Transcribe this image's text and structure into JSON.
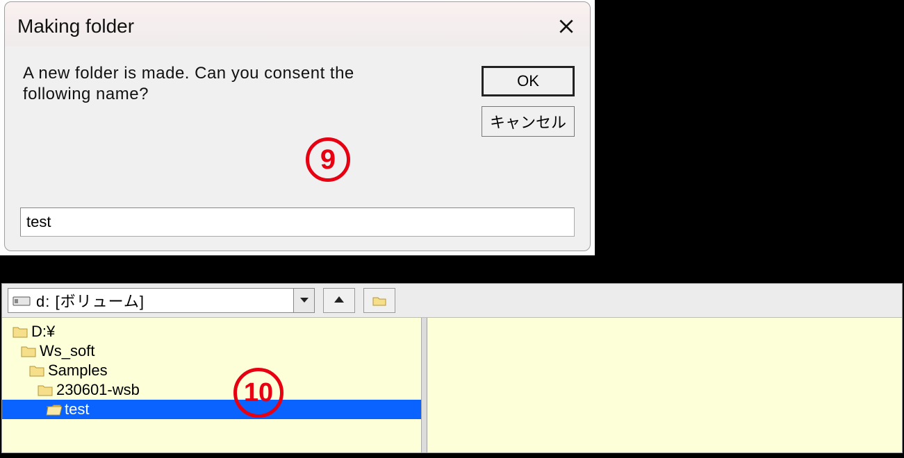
{
  "dialog": {
    "title": "Making folder",
    "message": "A new folder is made. Can you consent the following name?",
    "ok_label": "OK",
    "cancel_label": "キャンセル",
    "input_value": "test"
  },
  "annotations": {
    "n9": "9",
    "n10": "10"
  },
  "panel": {
    "drive_label": "d: [ボリューム]",
    "tree": [
      {
        "label": "D:¥",
        "indent": 0,
        "selected": false
      },
      {
        "label": "Ws_soft",
        "indent": 1,
        "selected": false
      },
      {
        "label": "Samples",
        "indent": 2,
        "selected": false
      },
      {
        "label": "230601-wsb",
        "indent": 3,
        "selected": false
      },
      {
        "label": "test",
        "indent": 4,
        "selected": true
      }
    ]
  }
}
